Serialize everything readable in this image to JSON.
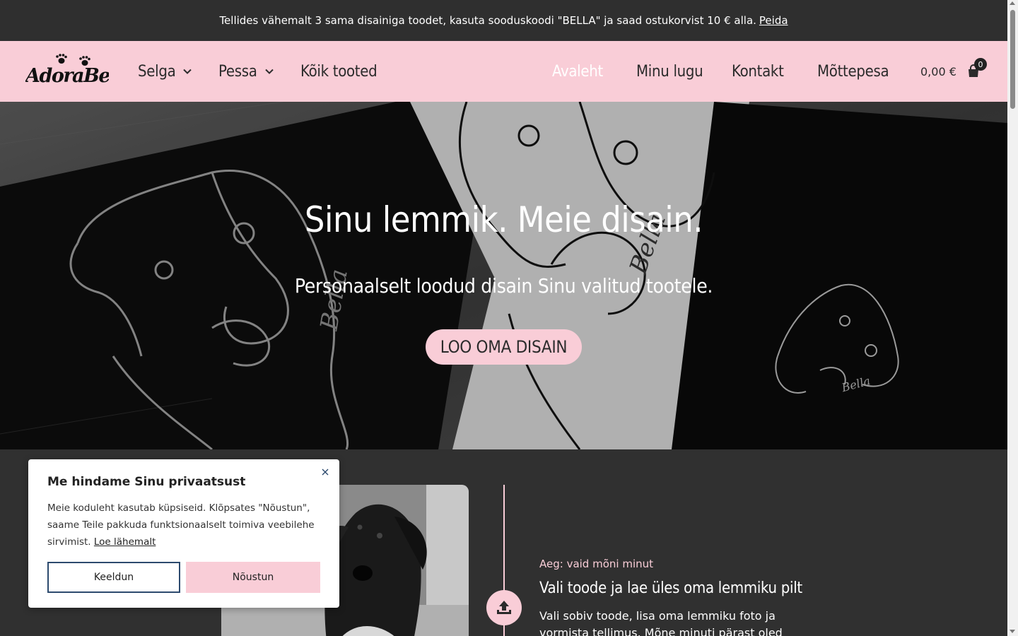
{
  "announcement": {
    "text": "Tellides vähemalt 3 sama disainiga toodet, kasuta sooduskoodi \"BELLA\" ja saad ostukorvist 10 € alla.",
    "dismiss_label": "Peida"
  },
  "header": {
    "logo_text": "AdoraBella",
    "nav_left": [
      {
        "label": "Selga",
        "has_dropdown": true
      },
      {
        "label": "Pessa",
        "has_dropdown": true
      },
      {
        "label": "Kõik tooted",
        "has_dropdown": false
      }
    ],
    "nav_right": [
      {
        "label": "Avaleht",
        "active": true
      },
      {
        "label": "Minu lugu",
        "active": false
      },
      {
        "label": "Kontakt",
        "active": false
      },
      {
        "label": "Mõttepesa",
        "active": false
      }
    ],
    "cart": {
      "total": "0,00 €",
      "count": "0",
      "icon": "shopping-bag-icon"
    }
  },
  "hero": {
    "title": "Sinu lemmik. Meie disain.",
    "subtitle": "Personaalselt loodud disain Sinu valitud tootele.",
    "cta_label": "LOO OMA DISAIN"
  },
  "step": {
    "time": "Aeg: vaid mõni minut",
    "title": "Vali toode ja lae üles oma lemmiku pilt",
    "text": "Vali sobiv toode, lisa oma lemmiku foto ja vormista tellimus. Mõne minuti pärast oled",
    "icon": "upload-icon"
  },
  "cookie": {
    "title": "Me hindame Sinu privaatsust",
    "text": "Meie koduleht kasutab küpsiseid. Klõpsates \"Nõustun\", saame Teile pakkuda funktsionaalselt toimiva veebilehe sirvimist.",
    "link_label": "Loe lähemalt",
    "decline_label": "Keeldun",
    "accept_label": "Nõustun"
  },
  "colors": {
    "accent": "#f9cdd7",
    "dark": "#303030",
    "decline_border": "#2c4a6e"
  }
}
